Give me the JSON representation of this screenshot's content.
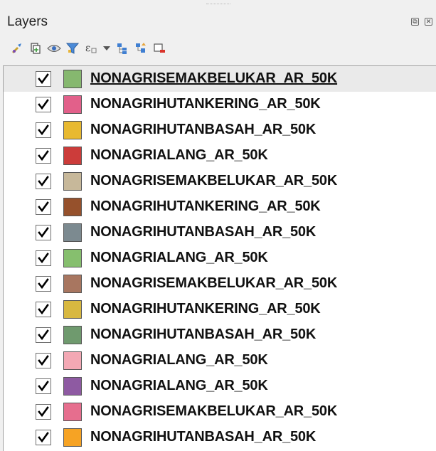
{
  "panel": {
    "title": "Layers",
    "float_glyph": "⧉",
    "close_glyph": "✕",
    "toolbar": [
      {
        "name": "style-manager-icon"
      },
      {
        "name": "add-group-icon"
      },
      {
        "name": "manage-visibility-icon"
      },
      {
        "name": "filter-legend-icon"
      },
      {
        "name": "filter-expression-icon"
      },
      {
        "name": "dropdown-arrow-icon"
      },
      {
        "name": "expand-all-icon"
      },
      {
        "name": "collapse-all-icon"
      },
      {
        "name": "remove-layer-icon"
      }
    ]
  },
  "layers": [
    {
      "name": "NONAGRISEMAKBELUKAR_AR_50K",
      "color": "#86b86f",
      "checked": true,
      "selected": true
    },
    {
      "name": "NONAGRIHUTANKERING_AR_50K",
      "color": "#e2608a",
      "checked": true
    },
    {
      "name": "NONAGRIHUTANBASAH_AR_50K",
      "color": "#e8b930",
      "checked": true
    },
    {
      "name": "NONAGRIALANG_AR_50K",
      "color": "#cc3c3a",
      "checked": true
    },
    {
      "name": "NONAGRISEMAKBELUKAR_AR_50K",
      "color": "#c7b89a",
      "checked": true
    },
    {
      "name": "NONAGRIHUTANKERING_AR_50K",
      "color": "#96512c",
      "checked": true
    },
    {
      "name": "NONAGRIHUTANBASAH_AR_50K",
      "color": "#7c8a90",
      "checked": true
    },
    {
      "name": "NONAGRIALANG_AR_50K",
      "color": "#86bf6e",
      "checked": true
    },
    {
      "name": "NONAGRISEMAKBELUKAR_AR_50K",
      "color": "#a87660",
      "checked": true
    },
    {
      "name": "NONAGRIHUTANKERING_AR_50K",
      "color": "#d8b840",
      "checked": true
    },
    {
      "name": "NONAGRIHUTANBASAH_AR_50K",
      "color": "#6f9a6e",
      "checked": true
    },
    {
      "name": "NONAGRIALANG_AR_50K",
      "color": "#f3a8b4",
      "checked": true
    },
    {
      "name": "NONAGRIALANG_AR_50K",
      "color": "#8e5aa2",
      "checked": true
    },
    {
      "name": "NONAGRISEMAKBELUKAR_AR_50K",
      "color": "#e66e8e",
      "checked": true
    },
    {
      "name": "NONAGRIHUTANBASAH_AR_50K",
      "color": "#f6a324",
      "checked": true
    }
  ]
}
